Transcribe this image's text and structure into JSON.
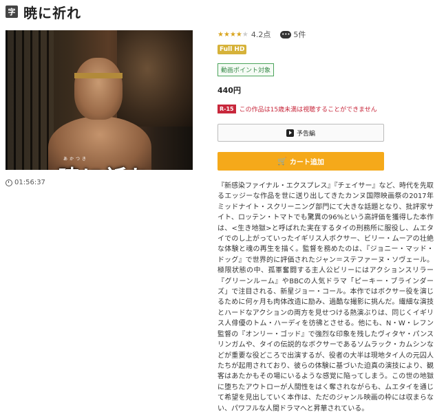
{
  "header": {
    "subtitle_badge": "字",
    "title": "暁に祈れ"
  },
  "poster": {
    "title_text": "暁に祈れ",
    "ruby": "あかつき"
  },
  "duration": "01:56:37",
  "rating": {
    "stars_filled": 4,
    "stars_total": 5,
    "value": "4.2点",
    "comment_count": "5件"
  },
  "badges": {
    "fullhd": "Full HD",
    "point": "動画ポイント対象"
  },
  "price": "440円",
  "restriction": {
    "badge": "R-15",
    "text": "この作品は15歳未満は視聴することができません"
  },
  "buttons": {
    "trailer": "予告編",
    "cart": "カート追加"
  },
  "description": "『新感染ファイナル・エクスプレス』『チェイサー』など、時代を先取るエッジーな作品を世に送り出してきたカンヌ国際映画祭の2017年ミッドナイト・スクリーニング部門にて大きな話題となり、批評家サイト、ロッテン・トマトでも驚異の96%という高評価を獲得した本作は、<生き地獄>と呼ばれた実在するタイの刑務所に服役し、ムエタイでのし上がっていったイギリス人ボクサー、ビリー・ムーアの壮絶な体験と魂の再生を描く。監督を務めたのは、『ジョニー・マッド・ドッグ』で世界的に評価されたジャン＝ステファーヌ・ソヴェール。極限状態の中、孤軍奮闘する主人公ビリーにはアクションスリラー『グリーンルーム』やBBCの人気ドラマ「ピーキー・ブラインダーズ」で注目される、新星ジョー・コール。本作ではボクサー役を演じるために何ヶ月も肉体改造に励み、過酷な撮影に挑んだ。繊細な演技とハードなアクションの両方を見せつける熱演ぶりは、同じくイギリス人俳優のトム・ハーディを彷彿とさせる。他にも、N・W・レフン監督の『オンリー・ゴッド』で強烈な印象を残したヴィタヤ・パンスリンガムや、タイの伝説的なボクサーであるソムラック・カムシンなどが重要な役どころで出演するが、役者の大半は現地タイ人の元囚人たちが起用されており、彼らの体験に基づいた迫真の演技により、観客はあたかもその場にいるような感覚に陥ってしまう。この世の地獄に堕ちたアウトローが人間性をはく奪されながらも、ムエタイを通じて希望を見出していく本作は、ただのジャンル映画の枠には収まらない、パワフルな人間ドラマへと昇華されている。",
  "colors": {
    "star": "#d9a520",
    "fullhd": "#d6b23a",
    "point_border": "#4aa35a",
    "restriction": "#c8283c",
    "cart": "#f5a91a"
  },
  "icons": {
    "comment": "comment-icon",
    "clock": "clock-icon",
    "play": "play-icon",
    "cart": "cart-icon"
  }
}
